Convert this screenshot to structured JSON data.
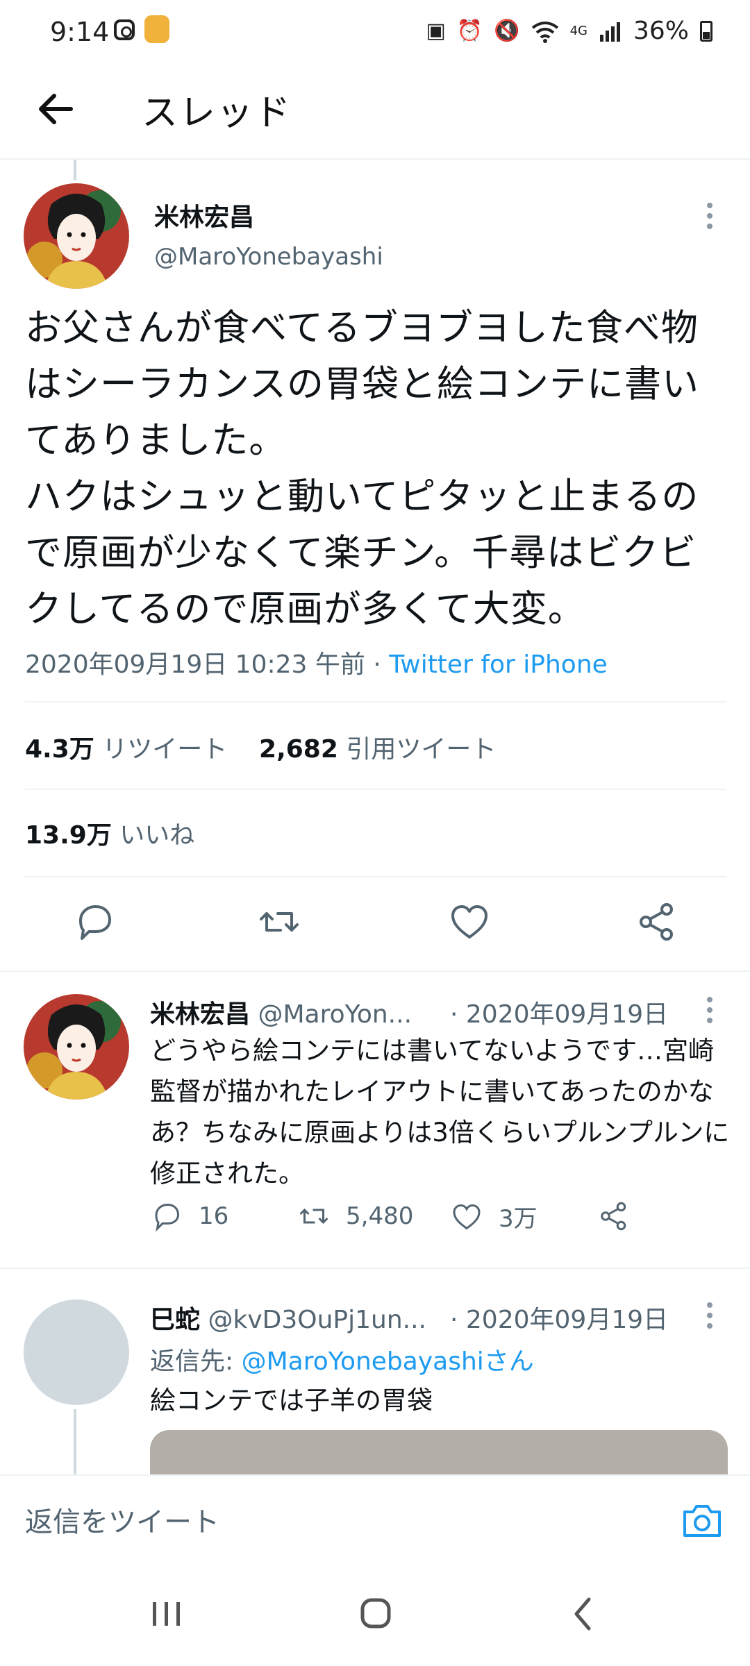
{
  "status_bar": {
    "time": "9:14",
    "network": "4G",
    "battery": "36%",
    "icons": [
      "instagram-icon",
      "app-icon",
      "battery-saver-icon",
      "alarm-icon",
      "mute-icon",
      "wifi-icon",
      "signal-icon",
      "battery-icon"
    ]
  },
  "header": {
    "title": "スレッド"
  },
  "main_tweet": {
    "name": "米林宏昌",
    "handle": "@MaroYonebayashi",
    "text": "お父さんが食べてるブヨブヨした食べ物はシーラカンスの胃袋と絵コンテに書いてありました。\nハクはシュッと動いてピタッと止まるので原画が少なくて楽チン。千尋はビクビクしてるので原画が多くて大変。",
    "datetime": "2020年09月19日 10:23 午前",
    "separator": " · ",
    "source": "Twitter for iPhone",
    "retweets_count": "4.3万",
    "retweets_label": "リツイート",
    "quotes_count": "2,682",
    "quotes_label": "引用ツイート",
    "likes_count": "13.9万",
    "likes_label": "いいね"
  },
  "replies": [
    {
      "name": "米林宏昌",
      "handle": "@MaroYon...",
      "date": "· 2020年09月19日",
      "text": "どうやら絵コンテには書いてないようです…宮崎監督が描かれたレイアウトに書いてあったのかなあ？ちなみに原画よりは3倍くらいプルンプルンに修正された。",
      "replies": "16",
      "retweets": "5,480",
      "likes": "3万"
    },
    {
      "name": "巳蛇",
      "handle": "@kvD3OuPj1un...",
      "date": "· 2020年09月19日",
      "reply_to_label": "返信先: ",
      "reply_to_handle": "@MaroYonebayashiさん",
      "text": "絵コンテでは子羊の胃袋"
    }
  ],
  "compose": {
    "placeholder": "返信をツイート"
  },
  "colors": {
    "accent": "#1d9bf0",
    "secondary_text": "#536471",
    "divider": "#eff3f4"
  }
}
